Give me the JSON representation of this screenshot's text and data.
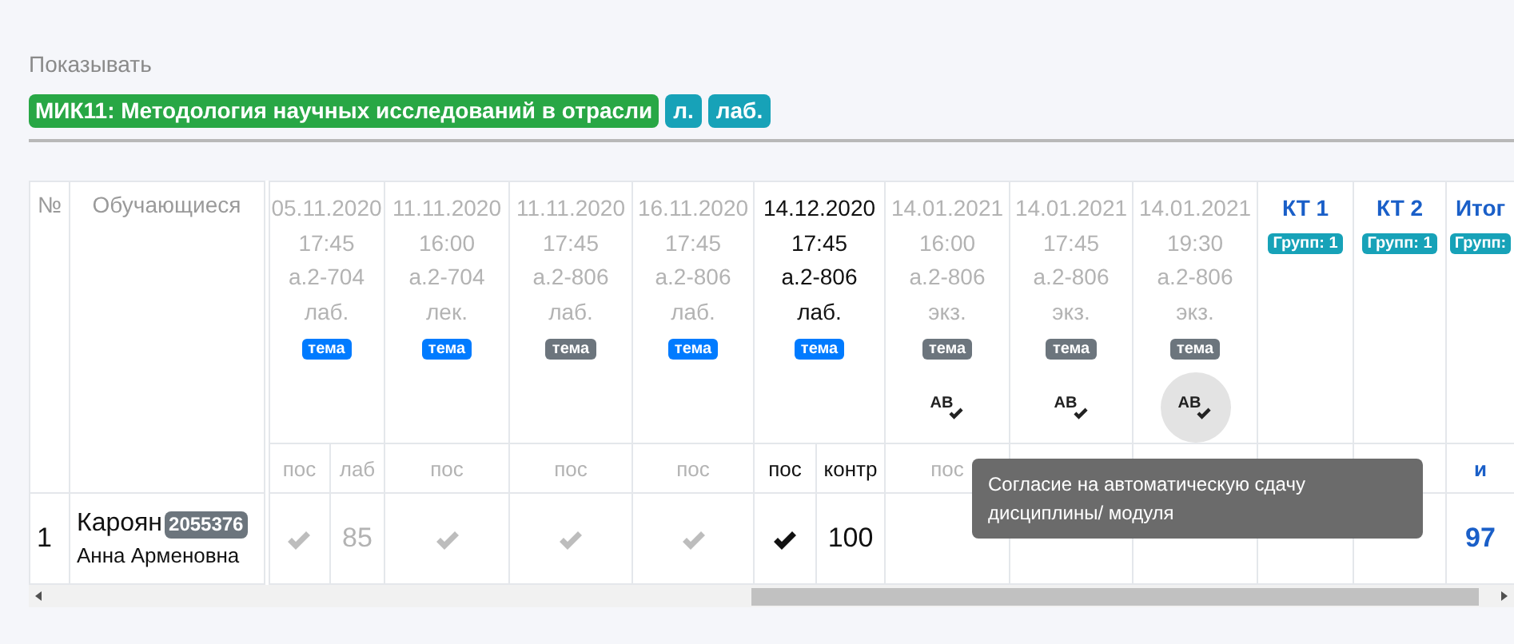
{
  "filter_label": "Показывать",
  "discipline": {
    "title": "МИК11: Методология научных исследований в отрасли",
    "tags": [
      "л.",
      "лаб."
    ]
  },
  "table": {
    "number_header": "№",
    "students_header": "Обучающиеся",
    "lessons": [
      {
        "date": "05.11.2020",
        "time": "17:45",
        "room": "а.2-704",
        "type": "лаб.",
        "muted": true,
        "topic": {
          "label": "тема",
          "active": true
        },
        "subcolumns": [
          "пос",
          "лаб"
        ]
      },
      {
        "date": "11.11.2020",
        "time": "16:00",
        "room": "а.2-704",
        "type": "лек.",
        "muted": true,
        "topic": {
          "label": "тема",
          "active": true
        },
        "subcolumns": [
          "пос"
        ]
      },
      {
        "date": "11.11.2020",
        "time": "17:45",
        "room": "а.2-806",
        "type": "лаб.",
        "muted": true,
        "topic": {
          "label": "тема",
          "active": false
        },
        "subcolumns": [
          "пос"
        ]
      },
      {
        "date": "16.11.2020",
        "time": "17:45",
        "room": "а.2-806",
        "type": "лаб.",
        "muted": true,
        "topic": {
          "label": "тема",
          "active": true
        },
        "subcolumns": [
          "пос"
        ]
      },
      {
        "date": "14.12.2020",
        "time": "17:45",
        "room": "а.2-806",
        "type": "лаб.",
        "muted": false,
        "topic": {
          "label": "тема",
          "active": true
        },
        "subcolumns": [
          "пос",
          "контр"
        ]
      },
      {
        "date": "14.01.2021",
        "time": "16:00",
        "room": "а.2-806",
        "type": "экз.",
        "muted": true,
        "topic": {
          "label": "тема",
          "active": false
        },
        "auto_consent": {
          "label": "AB",
          "hovered": false
        },
        "subcolumns": [
          "пос"
        ]
      },
      {
        "date": "14.01.2021",
        "time": "17:45",
        "room": "а.2-806",
        "type": "экз.",
        "muted": true,
        "topic": {
          "label": "тема",
          "active": false
        },
        "auto_consent": {
          "label": "AB",
          "hovered": false
        }
      },
      {
        "date": "14.01.2021",
        "time": "19:30",
        "room": "а.2-806",
        "type": "экз.",
        "muted": true,
        "topic": {
          "label": "тема",
          "active": false
        },
        "auto_consent": {
          "label": "AB",
          "hovered": true
        }
      }
    ],
    "checkpoints": [
      {
        "title": "КТ 1",
        "badge": "Групп: 1"
      },
      {
        "title": "КТ 2",
        "badge": "Групп: 1"
      },
      {
        "title": "Итог",
        "badge": "Групп:",
        "subheader": "и"
      }
    ],
    "rows": [
      {
        "number": "1",
        "surname": "Кароян",
        "record_id": "2055376",
        "given_names": "Анна Арменовна",
        "cells": [
          {
            "kind": "check",
            "muted": true
          },
          {
            "kind": "text",
            "value": "85",
            "muted": true
          },
          {
            "kind": "check",
            "muted": true
          },
          {
            "kind": "check",
            "muted": true
          },
          {
            "kind": "check",
            "muted": true
          },
          {
            "kind": "check",
            "muted": false
          },
          {
            "kind": "text",
            "value": "100",
            "muted": false
          },
          {
            "kind": "empty"
          },
          {
            "kind": "empty"
          },
          {
            "kind": "empty"
          },
          {
            "kind": "empty"
          },
          {
            "kind": "empty"
          },
          {
            "kind": "score",
            "value": "97"
          }
        ]
      }
    ]
  },
  "tooltip": "Согласие на автоматическую сдачу дисциплины/ модуля"
}
